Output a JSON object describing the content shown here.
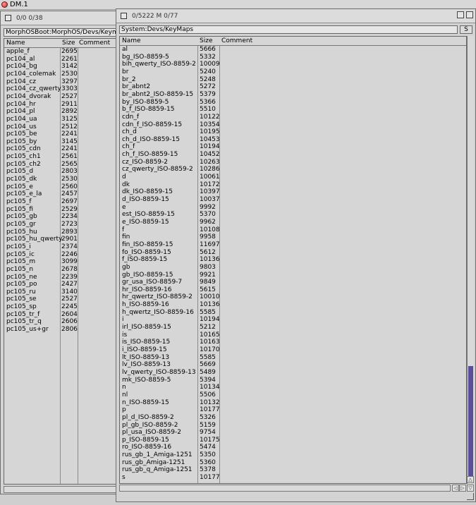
{
  "screen": {
    "title": "DM.1"
  },
  "left_window": {
    "title": "0/0 0/38",
    "path": "MorphOSBoot:MorphOS/Devs/Keymaps",
    "columns": {
      "name": "Name",
      "size": "Size",
      "comment": "Comment"
    },
    "rows": [
      {
        "name": "apple_f",
        "size": "2695"
      },
      {
        "name": "pc104_al",
        "size": "2261"
      },
      {
        "name": "pc104_bg",
        "size": "3142"
      },
      {
        "name": "pc104_colemak",
        "size": "2530"
      },
      {
        "name": "pc104_cz",
        "size": "3297"
      },
      {
        "name": "pc104_cz_qwerty",
        "size": "3303"
      },
      {
        "name": "pc104_dvorak",
        "size": "2527"
      },
      {
        "name": "pc104_hr",
        "size": "2911"
      },
      {
        "name": "pc104_pl",
        "size": "2892"
      },
      {
        "name": "pc104_ua",
        "size": "3125"
      },
      {
        "name": "pc104_us",
        "size": "2512"
      },
      {
        "name": "pc105_be",
        "size": "2241"
      },
      {
        "name": "pc105_by",
        "size": "3145"
      },
      {
        "name": "pc105_cdn",
        "size": "2241"
      },
      {
        "name": "pc105_ch1",
        "size": "2561"
      },
      {
        "name": "pc105_ch2",
        "size": "2565"
      },
      {
        "name": "pc105_d",
        "size": "2803"
      },
      {
        "name": "pc105_dk",
        "size": "2530"
      },
      {
        "name": "pc105_e",
        "size": "2560"
      },
      {
        "name": "pc105_e_la",
        "size": "2457"
      },
      {
        "name": "pc105_f",
        "size": "2697"
      },
      {
        "name": "pc105_fi",
        "size": "2529"
      },
      {
        "name": "pc105_gb",
        "size": "2234"
      },
      {
        "name": "pc105_gr",
        "size": "2723"
      },
      {
        "name": "pc105_hu",
        "size": "2893"
      },
      {
        "name": "pc105_hu_qwerty",
        "size": "2901"
      },
      {
        "name": "pc105_i",
        "size": "2374"
      },
      {
        "name": "pc105_ic",
        "size": "2246"
      },
      {
        "name": "pc105_m",
        "size": "3099"
      },
      {
        "name": "pc105_n",
        "size": "2678"
      },
      {
        "name": "pc105_ne",
        "size": "2239"
      },
      {
        "name": "pc105_po",
        "size": "2427"
      },
      {
        "name": "pc105_ru",
        "size": "3140"
      },
      {
        "name": "pc105_se",
        "size": "2527"
      },
      {
        "name": "pc105_sp",
        "size": "2245"
      },
      {
        "name": "pc105_tr_f",
        "size": "2604"
      },
      {
        "name": "pc105_tr_q",
        "size": "2606"
      },
      {
        "name": "pc105_us+gr",
        "size": "2806"
      }
    ]
  },
  "right_window": {
    "title": "0/5222 M 0/77",
    "path": "System:Devs/KeyMaps",
    "s_button": "S",
    "columns": {
      "name": "Name",
      "size": "Size",
      "comment": "Comment"
    },
    "scroll_position": 0.0,
    "rows": [
      {
        "name": "al",
        "size": "5666"
      },
      {
        "name": "bg_ISO-8859-5",
        "size": "5332"
      },
      {
        "name": "bih_qwerty_ISO-8859-2",
        "size": "10009"
      },
      {
        "name": "br",
        "size": "5240"
      },
      {
        "name": "br_2",
        "size": "5248"
      },
      {
        "name": "br_abnt2",
        "size": "5272"
      },
      {
        "name": "br_abnt2_ISO-8859-15",
        "size": "5379"
      },
      {
        "name": "by_ISO-8859-5",
        "size": "5366"
      },
      {
        "name": "b_f_ISO-8859-15",
        "size": "5510"
      },
      {
        "name": "cdn_f",
        "size": "10122"
      },
      {
        "name": "cdn_f_ISO-8859-15",
        "size": "10354"
      },
      {
        "name": "ch_d",
        "size": "10195"
      },
      {
        "name": "ch_d_ISO-8859-15",
        "size": "10453"
      },
      {
        "name": "ch_f",
        "size": "10194"
      },
      {
        "name": "ch_f_ISO-8859-15",
        "size": "10452"
      },
      {
        "name": "cz_ISO-8859-2",
        "size": "10263"
      },
      {
        "name": "cz_qwerty_ISO-8859-2",
        "size": "10286"
      },
      {
        "name": "d",
        "size": "10061"
      },
      {
        "name": "dk",
        "size": "10172"
      },
      {
        "name": "dk_ISO-8859-15",
        "size": "10397"
      },
      {
        "name": "d_ISO-8859-15",
        "size": "10037"
      },
      {
        "name": "e",
        "size": "9992"
      },
      {
        "name": "est_ISO-8859-15",
        "size": "5370"
      },
      {
        "name": "e_ISO-8859-15",
        "size": "9962"
      },
      {
        "name": "f",
        "size": "10108"
      },
      {
        "name": "fin",
        "size": "9958"
      },
      {
        "name": "fin_ISO-8859-15",
        "size": "11697"
      },
      {
        "name": "fo_ISO-8859-15",
        "size": "5612"
      },
      {
        "name": "f_ISO-8859-15",
        "size": "10136"
      },
      {
        "name": "gb",
        "size": "9803"
      },
      {
        "name": "gb_ISO-8859-15",
        "size": "9921"
      },
      {
        "name": "gr_usa_ISO-8859-7",
        "size": "9849"
      },
      {
        "name": "hr_ISO-8859-16",
        "size": "5615"
      },
      {
        "name": "hr_qwertz_ISO-8859-2",
        "size": "10010"
      },
      {
        "name": "h_ISO-8859-16",
        "size": "10136"
      },
      {
        "name": "h_qwertz_ISO-8859-16",
        "size": "5585"
      },
      {
        "name": "i",
        "size": "10194"
      },
      {
        "name": "irl_ISO-8859-15",
        "size": "5212"
      },
      {
        "name": "is",
        "size": "10165"
      },
      {
        "name": "is_ISO-8859-15",
        "size": "10163"
      },
      {
        "name": "i_ISO-8859-15",
        "size": "10170"
      },
      {
        "name": "lt_ISO-8859-13",
        "size": "5585"
      },
      {
        "name": "lv_ISO-8859-13",
        "size": "5669"
      },
      {
        "name": "lv_qwerty_ISO-8859-13",
        "size": "5489"
      },
      {
        "name": "mk_ISO-8859-5",
        "size": "5394"
      },
      {
        "name": "n",
        "size": "10134"
      },
      {
        "name": "nl",
        "size": "5506"
      },
      {
        "name": "n_ISO-8859-15",
        "size": "10132"
      },
      {
        "name": "p",
        "size": "10177"
      },
      {
        "name": "pl_d_ISO-8859-2",
        "size": "5326"
      },
      {
        "name": "pl_gb_ISO-8859-2",
        "size": "5159"
      },
      {
        "name": "pl_usa_ISO-8859-2",
        "size": "9754"
      },
      {
        "name": "p_ISO-8859-15",
        "size": "10175"
      },
      {
        "name": "ro_ISO-8859-16",
        "size": "5474"
      },
      {
        "name": "rus_gb_1_Amiga-1251",
        "size": "5350"
      },
      {
        "name": "rus_gb_Amiga-1251",
        "size": "5360"
      },
      {
        "name": "rus_gb_q_Amiga-1251",
        "size": "5378"
      },
      {
        "name": "s",
        "size": "10177"
      }
    ]
  },
  "colors": {
    "scroll_knob": "#5a4e9c",
    "window_bg": "#d3d3d3"
  }
}
